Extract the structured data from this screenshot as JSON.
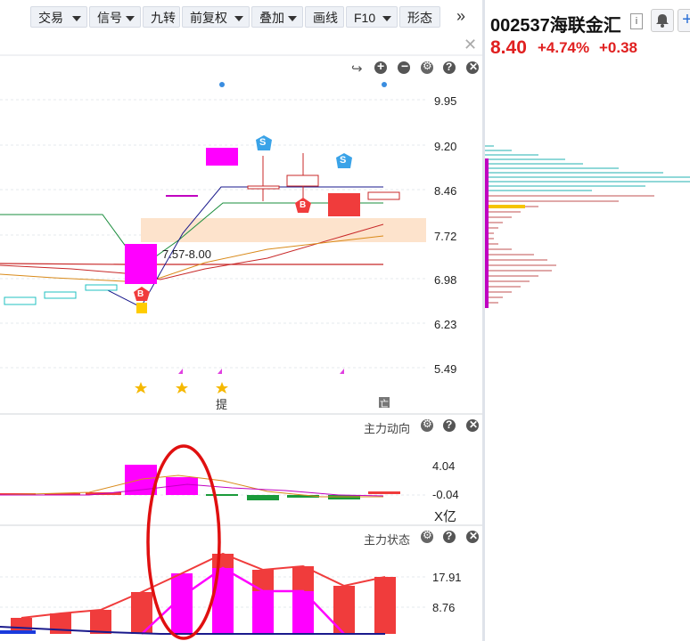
{
  "toolbar": {
    "items": [
      {
        "label": "交易",
        "dropdown": true
      },
      {
        "label": "信号",
        "dropdown": true
      },
      {
        "label": "九转",
        "dropdown": false
      },
      {
        "label": "前复权",
        "dropdown": true
      },
      {
        "label": "叠加",
        "dropdown": true
      },
      {
        "label": "画线",
        "dropdown": false
      },
      {
        "label": "F10",
        "dropdown": true
      },
      {
        "label": "形态",
        "dropdown": false
      }
    ],
    "more": "»",
    "close": "✕"
  },
  "stock": {
    "code_name": "002537海联金汇",
    "info": "i",
    "price": "8.40",
    "change_pct": "+4.74%",
    "change": "+0.38"
  },
  "main_chart": {
    "y_labels": [
      "9.95",
      "9.20",
      "8.46",
      "7.72",
      "6.98",
      "6.23",
      "5.49"
    ],
    "range_label": "7.57-8.00",
    "signal_b": "B",
    "signal_s": "S",
    "tag_ti": "提",
    "tag_wang": "亡",
    "colors": {
      "up": "#f03c3c",
      "highlight": "#ff00ff",
      "ma5": "#1a1a8c",
      "ma10": "#1a8c3c",
      "ma20": "#d98a1a",
      "ma60": "#c82828",
      "band": "#fde3cc"
    }
  },
  "flow_panel": {
    "title": "主力动向",
    "y_labels": [
      "4.04",
      "-0.04"
    ],
    "unit": "X亿"
  },
  "state_panel": {
    "title": "主力状态",
    "y_labels": [
      "17.91",
      "8.76"
    ]
  }
}
